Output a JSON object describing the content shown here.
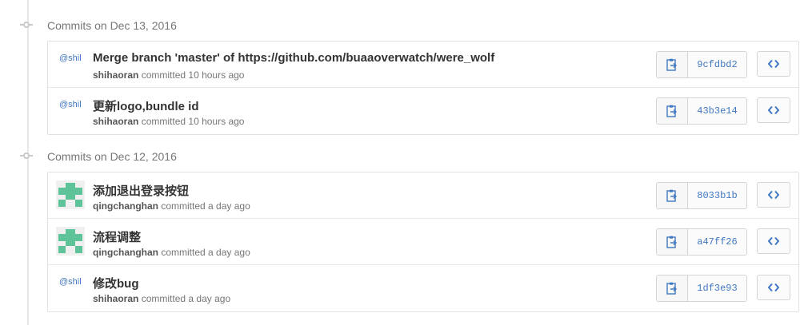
{
  "groups": [
    {
      "title": "Commits on Dec 13, 2016",
      "commits": [
        {
          "avatar_text": "@shil",
          "message": "Merge branch 'master' of https://github.com/buaaoverwatch/were_wolf",
          "author": "shihaoran",
          "verb": "committed",
          "time": "10 hours ago",
          "sha": "9cfdbd2"
        },
        {
          "avatar_text": "@shil",
          "message": "更新logo,bundle id",
          "author": "shihaoran",
          "verb": "committed",
          "time": "10 hours ago",
          "sha": "43b3e14"
        }
      ]
    },
    {
      "title": "Commits on Dec 12, 2016",
      "commits": [
        {
          "avatar_text": "",
          "message": "添加退出登录按钮",
          "author": "qingchanghan",
          "verb": "committed",
          "time": "a day ago",
          "sha": "8033b1b"
        },
        {
          "avatar_text": "",
          "message": "流程调整",
          "author": "qingchanghan",
          "verb": "committed",
          "time": "a day ago",
          "sha": "a47ff26"
        },
        {
          "avatar_text": "@shil",
          "message": "修改bug",
          "author": "shihaoran",
          "verb": "committed",
          "time": "a day ago",
          "sha": "1df3e93"
        }
      ]
    }
  ],
  "icons": {
    "copy": "clipboard-icon",
    "browse": "code-icon",
    "timeline": "commit-node-icon"
  },
  "colors": {
    "link": "#4078c0",
    "identicon": "#5fc39a"
  }
}
